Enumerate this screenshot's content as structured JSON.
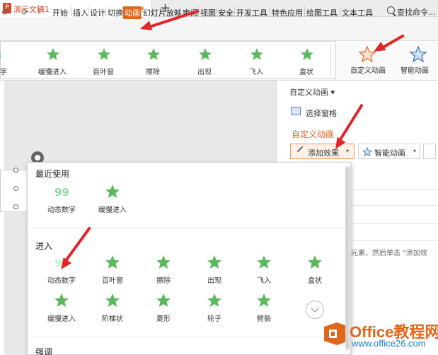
{
  "titlebar": {
    "app_logo": "P",
    "doc_title": "演示文稿1",
    "new_tab": "+"
  },
  "menubar": {
    "quick_access": [
      "↺",
      "⟳",
      "⩡"
    ],
    "items": [
      "开始",
      "插入",
      "设计",
      "切换",
      "动画",
      "幻灯片放映",
      "审阅",
      "视图",
      "安全",
      "开发工具",
      "特色应用",
      "绘图工具",
      "文本工具"
    ],
    "active_index": 4,
    "search_label": "查找命令..."
  },
  "ribbon": {
    "gallery": [
      {
        "label": "数字",
        "icon": "digit-anim-icon"
      },
      {
        "label": "缓慢进入",
        "icon": "star-icon"
      },
      {
        "label": "百叶窗",
        "icon": "star-icon"
      },
      {
        "label": "擦除",
        "icon": "star-icon"
      },
      {
        "label": "出现",
        "icon": "star-icon"
      },
      {
        "label": "飞入",
        "icon": "star-icon"
      },
      {
        "label": "盒状",
        "icon": "star-icon"
      }
    ],
    "custom_anim": "自定义动画",
    "smart_anim": "智能动画"
  },
  "panel": {
    "title": "自定义动画 ▾",
    "select_pane": "选择窗格",
    "section_title": "自定义动画",
    "add_effect": "添加效果",
    "smart_anim": "智能动画",
    "dropdown_arrow": "▾",
    "hint": "个元素，然后单击 \"添加效"
  },
  "dropdown": {
    "recent_title": "最近使用",
    "recent": [
      {
        "label": "动态数字",
        "icon": "digit-anim-icon",
        "glyph": "99"
      },
      {
        "label": "缓慢进入",
        "icon": "star-icon",
        "glyph": ""
      }
    ],
    "enter_title": "进入",
    "enter": [
      {
        "label": "动态数字",
        "icon": "digit-anim-icon",
        "glyph": "99"
      },
      {
        "label": "百叶窗",
        "icon": "star-icon",
        "glyph": ""
      },
      {
        "label": "擦除",
        "icon": "star-icon",
        "glyph": ""
      },
      {
        "label": "出现",
        "icon": "star-icon",
        "glyph": ""
      },
      {
        "label": "飞入",
        "icon": "star-icon",
        "glyph": ""
      },
      {
        "label": "盒状",
        "icon": "star-icon",
        "glyph": ""
      },
      {
        "label": "缓慢进入",
        "icon": "star-icon",
        "glyph": ""
      },
      {
        "label": "阶梯状",
        "icon": "star-icon",
        "glyph": ""
      },
      {
        "label": "菱形",
        "icon": "star-icon",
        "glyph": ""
      },
      {
        "label": "轮子",
        "icon": "star-icon",
        "glyph": ""
      },
      {
        "label": "劈裂",
        "icon": "star-icon",
        "glyph": ""
      }
    ],
    "emphasis_title": "强调"
  },
  "watermark": {
    "title": "Office教程网",
    "url": "www.office26.com"
  },
  "colors": {
    "accent": "#e0661a",
    "star": "#5cb85c",
    "arrow": "#e0262a",
    "link": "#1c7fc6"
  }
}
